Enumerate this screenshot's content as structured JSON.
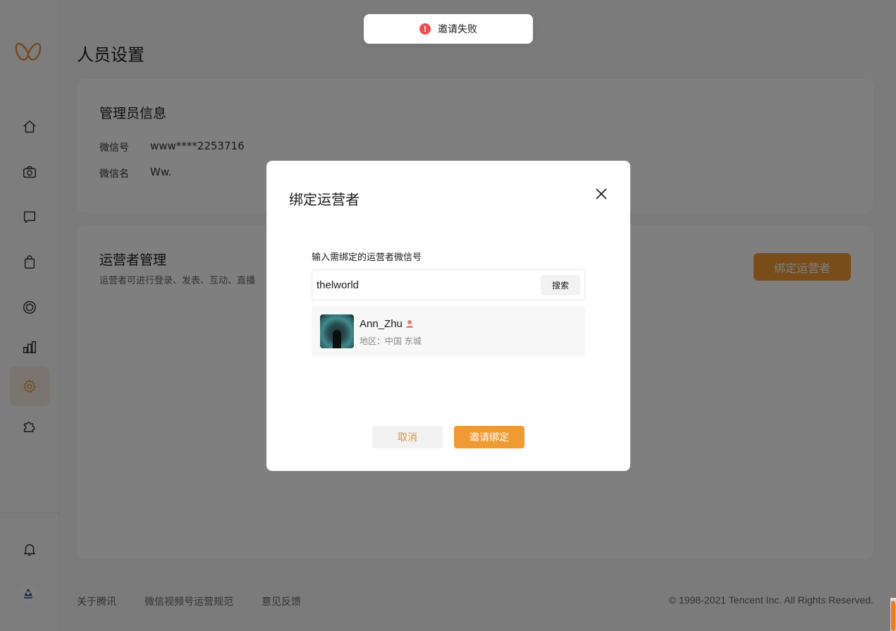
{
  "page": {
    "title": "人员设置"
  },
  "admin_card": {
    "title": "管理员信息",
    "wechat_id_label": "微信号",
    "wechat_id_value": "www****2253716",
    "wechat_name_label": "微信名",
    "wechat_name_value": "Ww."
  },
  "ops_card": {
    "title": "运营者管理",
    "description": "运营者可进行登录、发表、互动、直播",
    "bind_button": "绑定运营者"
  },
  "footer": {
    "links": [
      "关于腾讯",
      "微信视频号运营规范",
      "意见反馈"
    ],
    "copyright": "© 1998-2021 Tencent Inc. All Rights Reserved."
  },
  "toast": {
    "message": "邀请失败",
    "icon": "!",
    "color": "#f04d4d"
  },
  "modal": {
    "title": "绑定运营者",
    "field_label": "输入需绑定的运营者微信号",
    "search_value": "thelworld",
    "search_button": "搜索",
    "result": {
      "name": "Ann_Zhu",
      "gender_icon": "female-icon",
      "region": "地区：中国 东城"
    },
    "cancel_button": "取消",
    "invite_button": "邀请绑定"
  },
  "sidebar": {
    "items": [
      {
        "icon": "home-icon"
      },
      {
        "icon": "camera-icon"
      },
      {
        "icon": "message-icon"
      },
      {
        "icon": "bag-icon"
      },
      {
        "icon": "live-icon"
      },
      {
        "icon": "chart-icon"
      },
      {
        "icon": "gear-icon",
        "active": true
      },
      {
        "icon": "plugin-icon"
      }
    ],
    "bottom": [
      {
        "icon": "bell-icon"
      }
    ]
  },
  "colors": {
    "accent": "#f09a34",
    "error": "#f04d4d"
  }
}
